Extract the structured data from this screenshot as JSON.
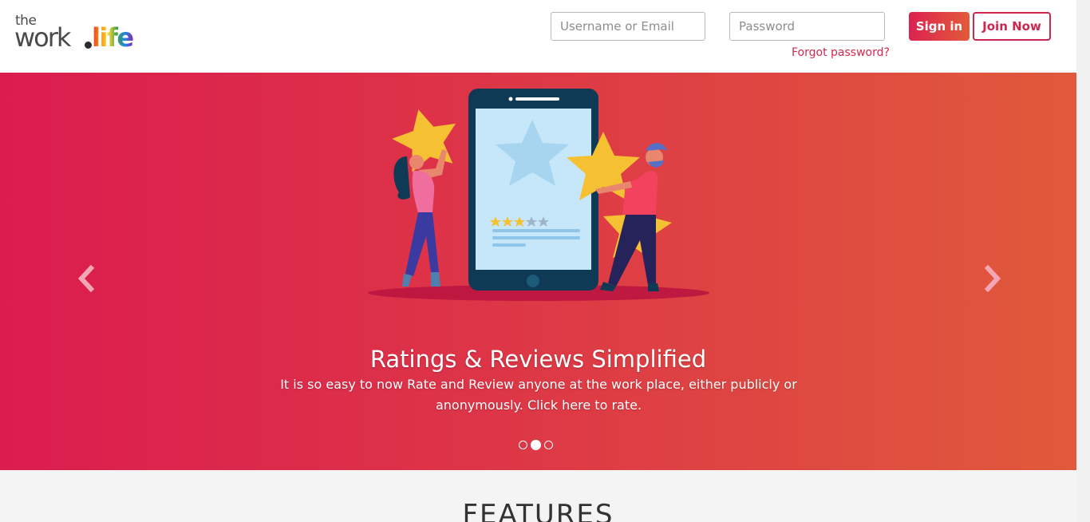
{
  "header": {
    "logo": {
      "the": "the",
      "work": "work",
      "life": "life"
    },
    "username_placeholder": "Username or Email",
    "password_placeholder": "Password",
    "forgot_password": "Forgot password?",
    "signin_label": "Sign in",
    "join_label": "Join Now"
  },
  "hero": {
    "title": "Ratings & Reviews Simplified",
    "description": "It is so easy to now Rate and Review anyone at the work place, either publicly or anonymously. Click here to rate.",
    "slides_count": 3,
    "active_slide": 2,
    "prev_icon": "chevron-left-icon",
    "next_icon": "chevron-right-icon",
    "rating_stars": 3,
    "rating_max": 5
  },
  "features": {
    "title": "FEATURES"
  },
  "colors": {
    "accent": "#d0294f",
    "gradient_start": "#db1c4f",
    "gradient_end": "#e05a3b",
    "star": "#f5c133"
  }
}
